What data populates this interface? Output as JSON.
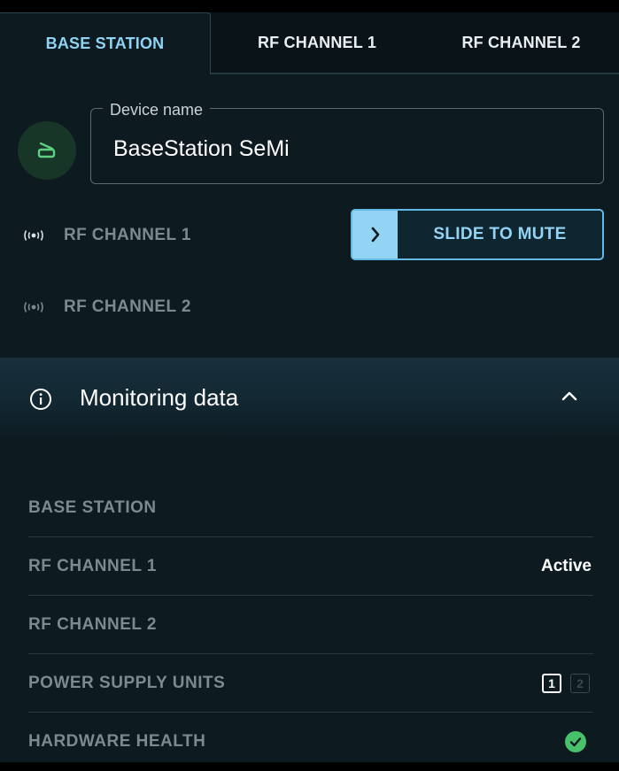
{
  "tabs": [
    {
      "label": "BASE STATION",
      "active": true
    },
    {
      "label": "RF CHANNEL 1",
      "active": false
    },
    {
      "label": "RF CHANNEL 2",
      "active": false
    }
  ],
  "device": {
    "field_label": "Device name",
    "name": "BaseStation SeMi",
    "icon": "base-station-icon"
  },
  "channels": [
    {
      "label": "RF CHANNEL 1",
      "icon": "broadcast-icon"
    },
    {
      "label": "RF CHANNEL 2",
      "icon": "broadcast-icon"
    }
  ],
  "slide_to_mute": {
    "label": "SLIDE TO MUTE",
    "icon": "chevron-right-icon"
  },
  "monitoring": {
    "title": "Monitoring data",
    "expanded": true,
    "rows": [
      {
        "label": "BASE STATION",
        "value": ""
      },
      {
        "label": "RF CHANNEL 1",
        "value": "Active"
      },
      {
        "label": "RF CHANNEL 2",
        "value": ""
      },
      {
        "label": "POWER SUPPLY UNITS",
        "units": [
          {
            "label": "1",
            "active": true
          },
          {
            "label": "2",
            "active": false
          }
        ]
      },
      {
        "label": "HARDWARE HEALTH",
        "status": "ok"
      }
    ]
  },
  "colors": {
    "accent": "#93d3f3",
    "background": "#0d1a20",
    "ok": "#49c16a",
    "muted_text": "#7c8a90"
  }
}
